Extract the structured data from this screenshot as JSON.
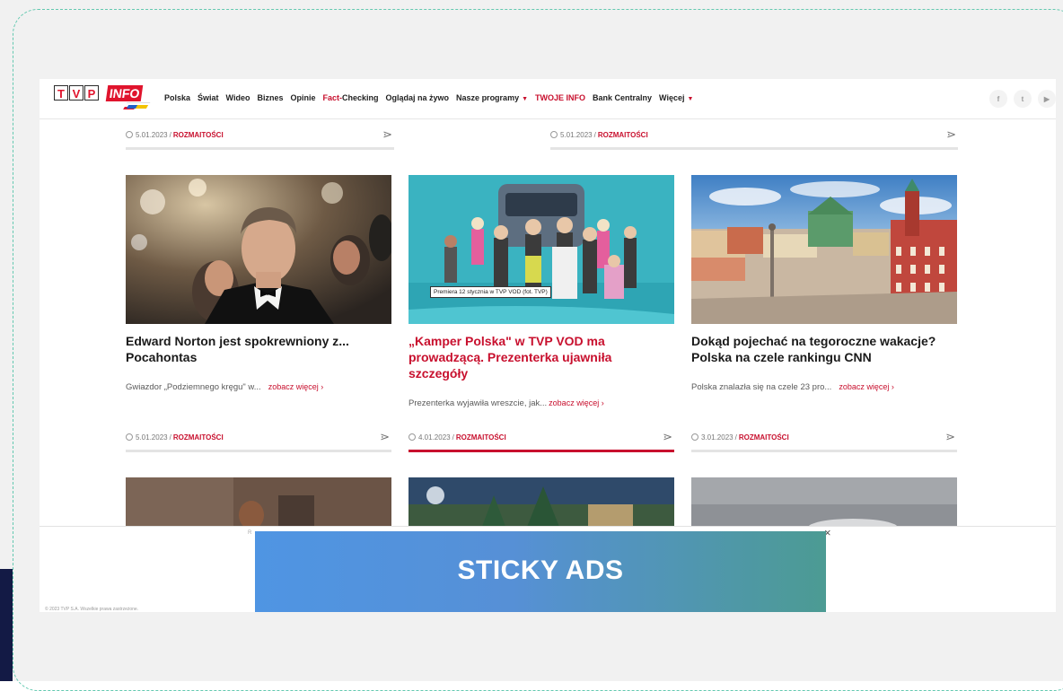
{
  "header": {
    "logo_tv": [
      "T",
      "V",
      "P"
    ],
    "logo_info": "INFO",
    "nav": [
      {
        "label": "Polska"
      },
      {
        "label": "Świat"
      },
      {
        "label": "Wideo"
      },
      {
        "label": "Biznes"
      },
      {
        "label": "Opinie"
      },
      {
        "label": "Fact-Checking",
        "red_part": "Fact-",
        "rest": "Checking"
      },
      {
        "label": "Oglądaj na żywo"
      },
      {
        "label": "Nasze programy",
        "dropdown": true
      },
      {
        "label": "TWOJE INFO",
        "red": true
      },
      {
        "label": "Bank Centralny"
      },
      {
        "label": "Więcej",
        "dropdown": true
      }
    ],
    "social": [
      {
        "icon": "facebook-icon",
        "glyph": "f"
      },
      {
        "icon": "twitter-icon",
        "glyph": "t"
      },
      {
        "icon": "youtube-icon",
        "glyph": "▶"
      }
    ]
  },
  "top_meta": [
    {
      "date": "5.01.2023",
      "category": "ROZMAITOŚCI"
    },
    {
      "date": "5.01.2023",
      "category": "ROZMAITOŚCI"
    }
  ],
  "articles": [
    {
      "title": "Edward Norton jest spokrewniony z... Pocahontas",
      "lead": "Gwiazdor „Podziemnego kręgu\" w...",
      "more": "zobacz więcej ›",
      "date": "5.01.2023",
      "category": "ROZMAITOŚCI"
    },
    {
      "title": "„Kamper Polska\" w TVP VOD ma prowadzącą. Prezenterka ujawniła szczegóły",
      "lead": "Prezenterka wyjawiła wreszcie, jak...",
      "more": "zobacz więcej ›",
      "caption": "Premiera 12 stycznia w TVP VOD (fot. TVP)",
      "date": "4.01.2023",
      "category": "ROZMAITOŚCI"
    },
    {
      "title": "Dokąd pojechać na tegoroczne wakacje? Polska na czele rankingu CNN",
      "lead": "Polska znalazła się na czele 23 pro...",
      "more": "zobacz więcej ›",
      "date": "3.01.2023",
      "category": "ROZMAITOŚCI"
    }
  ],
  "meta_separator": "/",
  "share_glyph": "⋗",
  "ad": {
    "label": "STICKY ADS",
    "close": "×",
    "strip_letter": "R",
    "tiny_text": "© 2023 TVP S.A. Wszelkie prawa zastrzeżone."
  },
  "colors": {
    "accent": "#c8102e",
    "ad_gradient_start": "#4f95e3",
    "ad_gradient_end": "#4c9b93",
    "frame_dash": "#63c9b0"
  }
}
